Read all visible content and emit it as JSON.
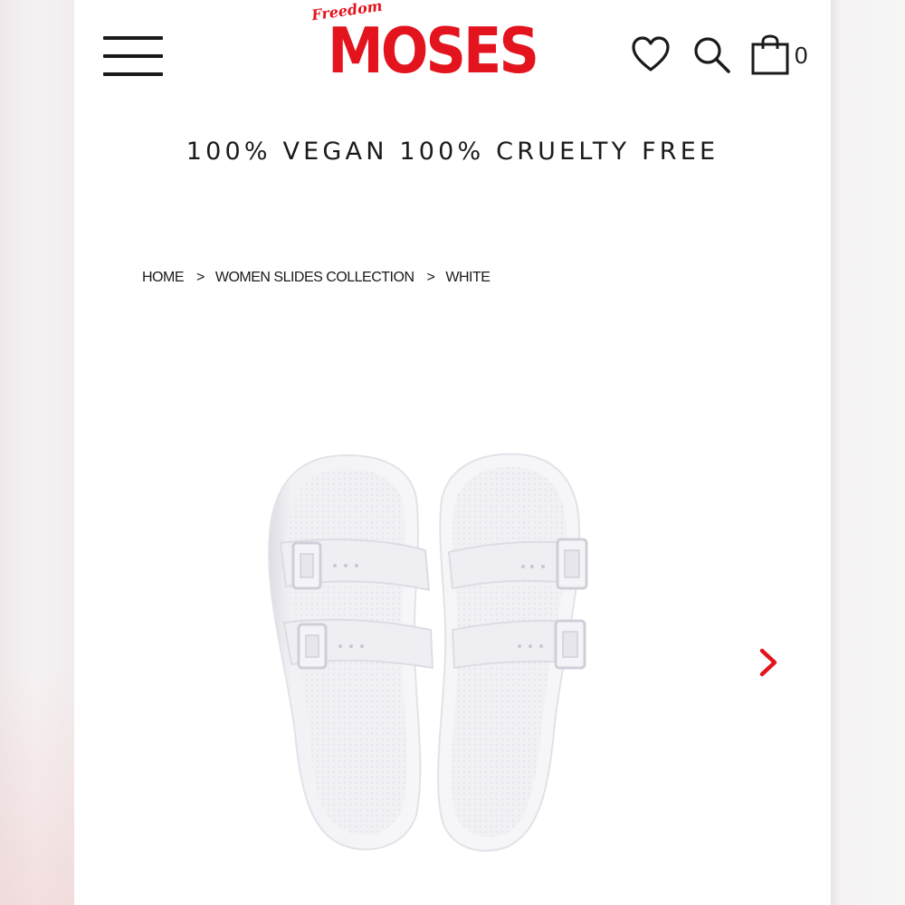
{
  "header": {
    "logo_small": "Freedom",
    "logo_main": "MOSES",
    "cart_count": "0",
    "icons": {
      "menu": "hamburger-menu-icon",
      "wishlist": "heart-icon",
      "search": "search-icon",
      "cart": "shopping-bag-icon"
    }
  },
  "tagline": "100% VEGAN 100% CRUELTY FREE",
  "breadcrumb": {
    "items": [
      "HOME",
      "WOMEN SLIDES COLLECTION",
      "WHITE"
    ],
    "separator": ">"
  },
  "gallery": {
    "next_icon": "chevron-right-icon"
  },
  "colors": {
    "brand": "#e3141d",
    "text": "#1a1a1a",
    "product": "#f0f0f4"
  }
}
